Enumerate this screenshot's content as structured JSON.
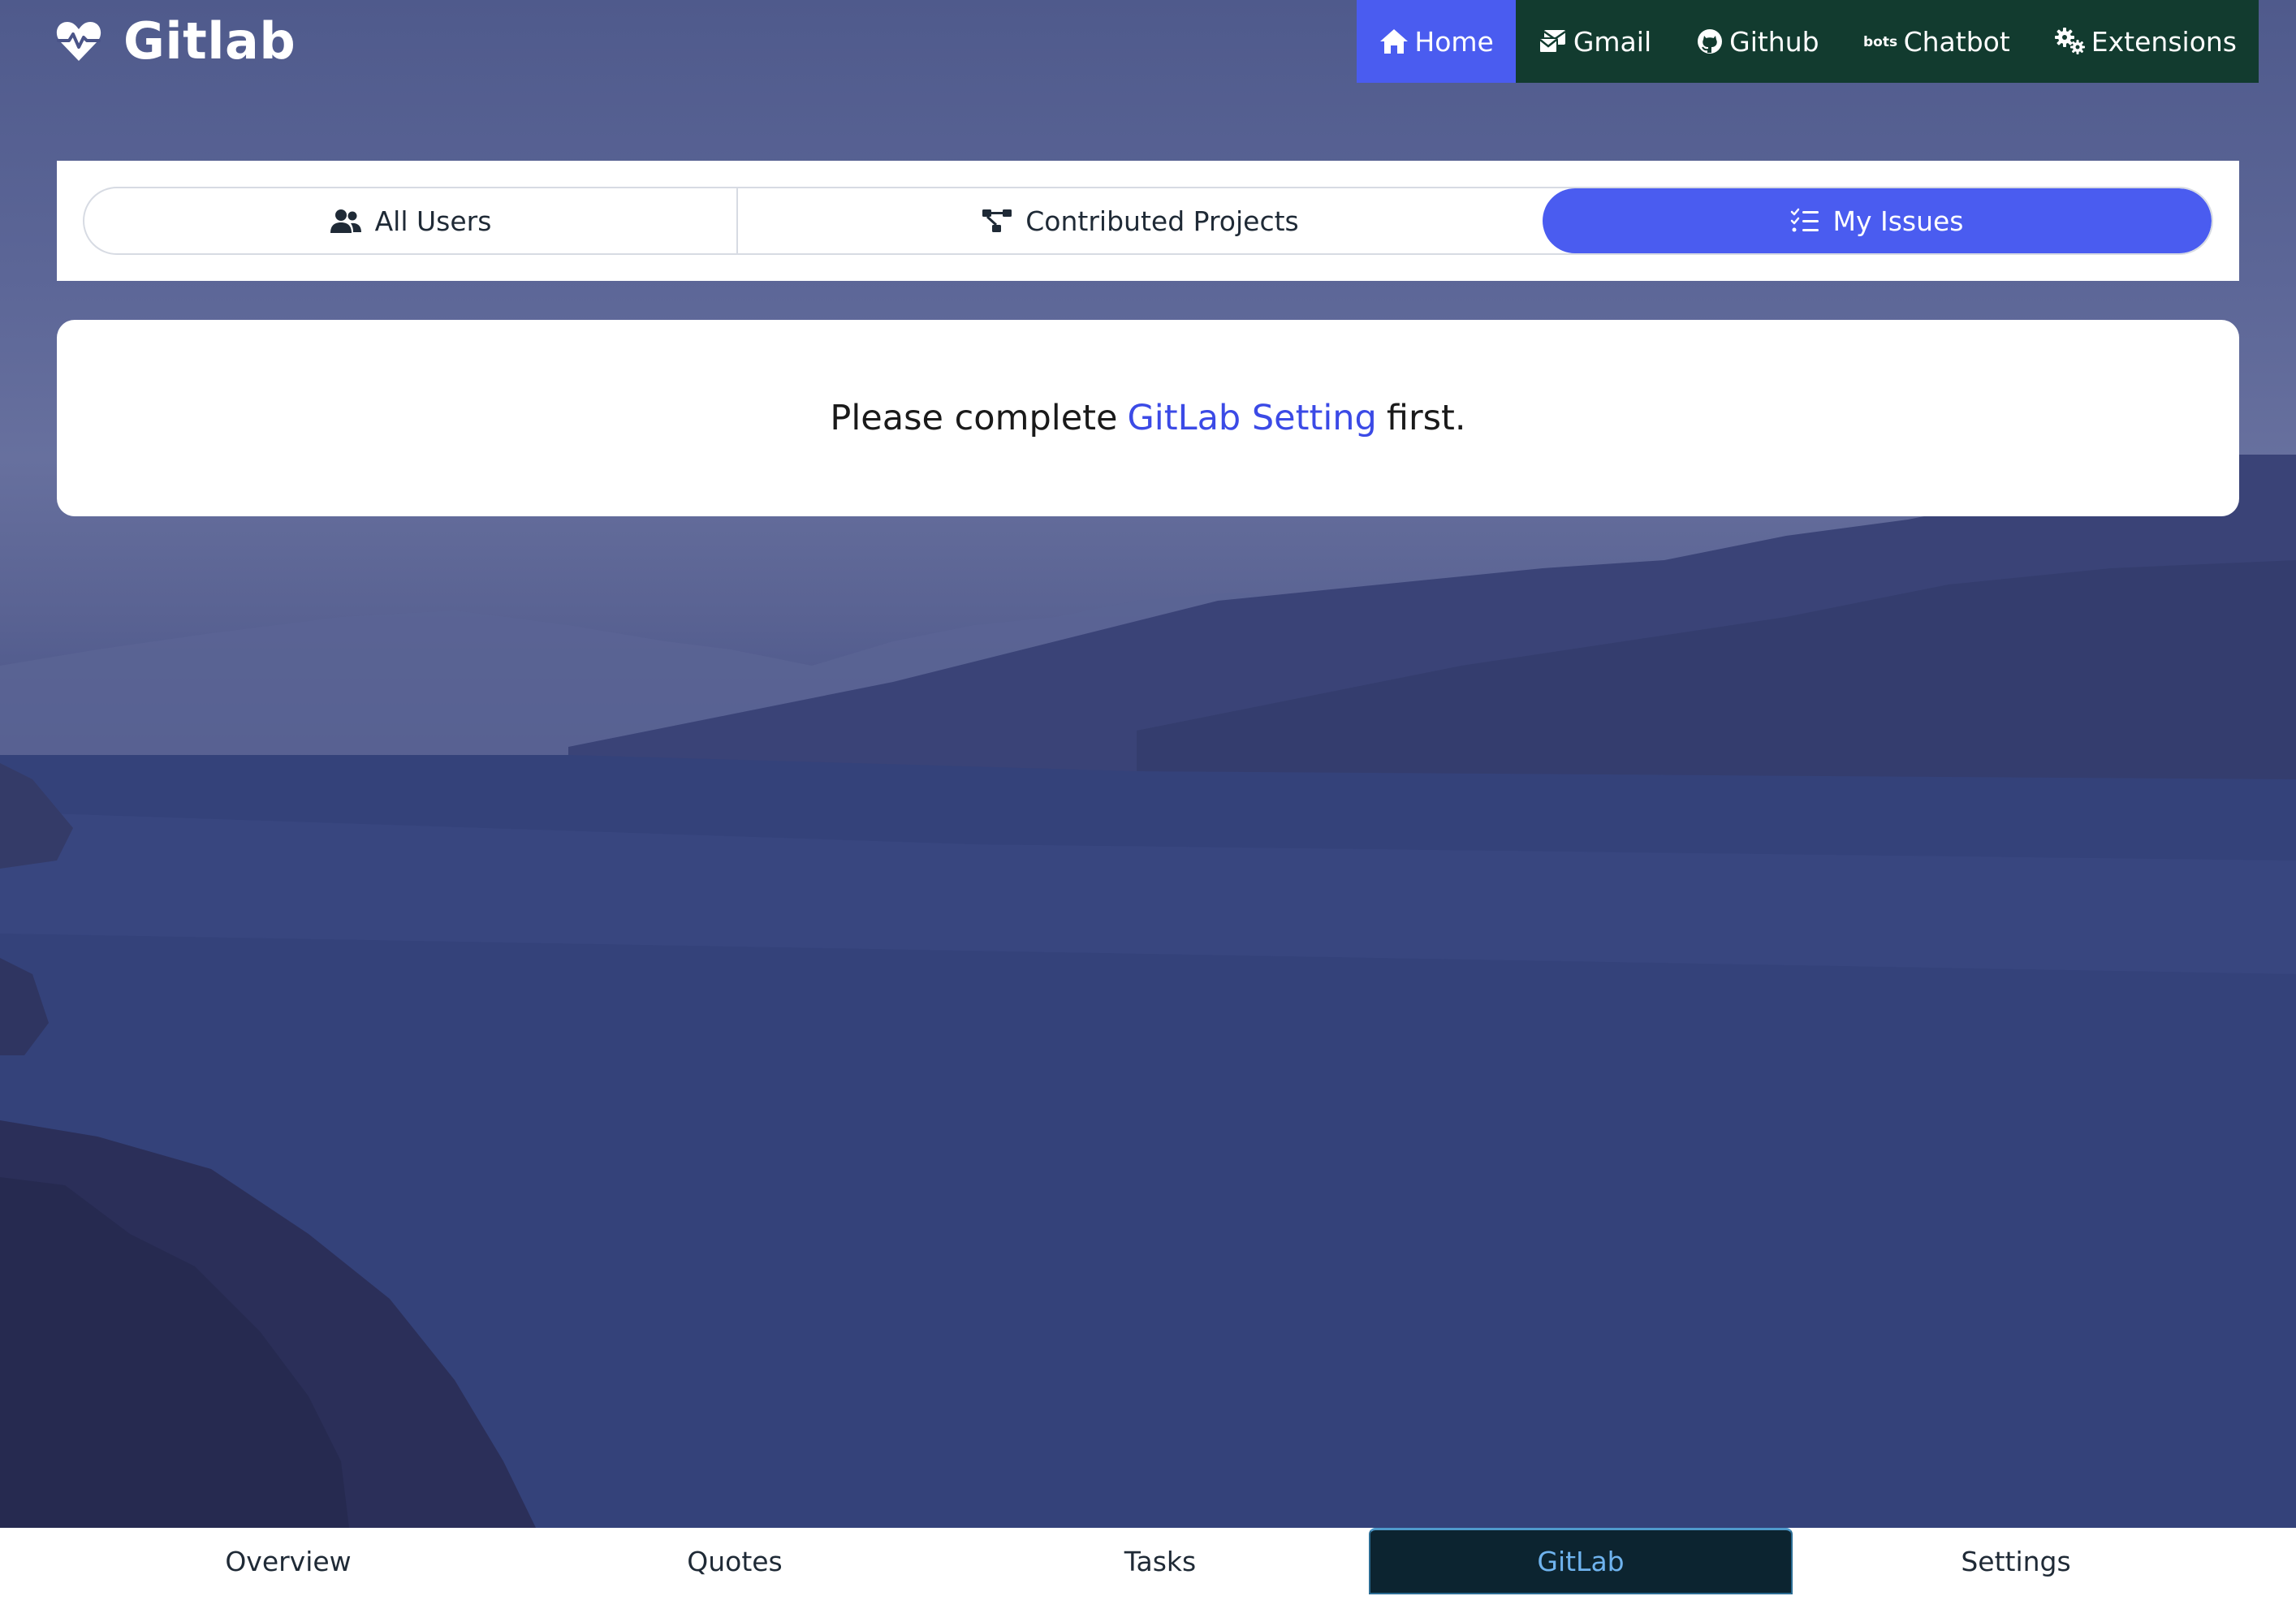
{
  "brand": {
    "name": "Gitlab",
    "icon": "heart-pulse-icon"
  },
  "topnav": {
    "items": [
      {
        "label": "Home",
        "icon": "home-icon",
        "active": true
      },
      {
        "label": "Gmail",
        "icon": "mail-icon",
        "active": false
      },
      {
        "label": "Github",
        "icon": "github-icon",
        "active": false
      },
      {
        "label": "Chatbot",
        "icon": "bots-icon",
        "active": false
      },
      {
        "label": "Extensions",
        "icon": "gears-icon",
        "active": false
      }
    ]
  },
  "tabs": {
    "items": [
      {
        "label": "All Users",
        "icon": "users-icon",
        "active": false
      },
      {
        "label": "Contributed Projects",
        "icon": "diagram-project-icon",
        "active": false
      },
      {
        "label": "My Issues",
        "icon": "list-check-icon",
        "active": true
      }
    ]
  },
  "message": {
    "prefix": "Please complete",
    "link": "GitLab Setting",
    "suffix": "first."
  },
  "bottombar": {
    "items": [
      {
        "label": "Overview",
        "active": false
      },
      {
        "label": "Quotes",
        "active": false
      },
      {
        "label": "Tasks",
        "active": false
      },
      {
        "label": "GitLab",
        "active": true
      },
      {
        "label": "Settings",
        "active": false
      }
    ]
  },
  "colors": {
    "accent": "#4a5cf0",
    "nav_background": "#123b2f",
    "link": "#3b4ae6",
    "active_bottom_tab_background": "#0c2430",
    "active_bottom_tab_text": "#6fb3ee"
  }
}
